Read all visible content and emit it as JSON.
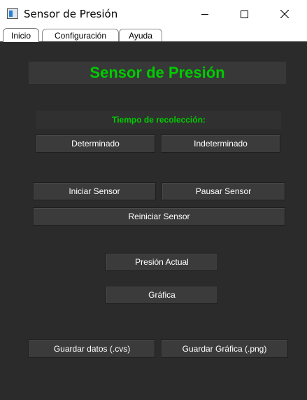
{
  "window": {
    "title": "Sensor de Presión",
    "icons": [
      "app-icon",
      "minimize-icon",
      "maximize-icon",
      "close-icon"
    ]
  },
  "tabs": [
    {
      "label": "Inicio",
      "active": true
    },
    {
      "label": "Configuración",
      "active": false
    },
    {
      "label": "Ayuda",
      "active": false
    }
  ],
  "main": {
    "heading": "Sensor de Presión",
    "collection_label": "Tiempo de recolección:",
    "buttons": {
      "determinado": "Determinado",
      "indeterminado": "Indeterminado",
      "iniciar": "Iniciar Sensor",
      "pausar": "Pausar Sensor",
      "reiniciar": "Reiniciar Sensor",
      "presion_actual": "Presión Actual",
      "grafica": "Gráfica",
      "guardar_datos": "Guardar datos (.cvs)",
      "guardar_grafica": "Guardar Gráfica (.png)"
    }
  },
  "colors": {
    "background": "#2b2b2b",
    "accent_green": "#00cc00",
    "button_bg": "#3b3b3b",
    "button_text": "#ffffff"
  }
}
